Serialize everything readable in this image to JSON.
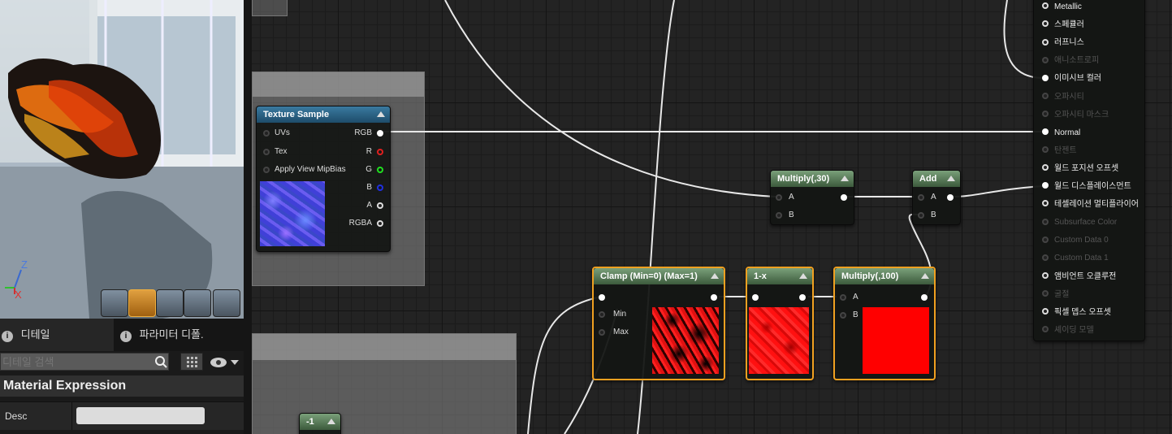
{
  "viewport": {
    "axis_z": "Z",
    "axis_x": "X",
    "preview_buttons": [
      "cylinder-preview-icon",
      "sphere-preview-icon",
      "plane-preview-icon",
      "cube-preview-icon",
      "custom-mesh-preview-icon"
    ]
  },
  "details": {
    "tab_details": "디테일",
    "tab_params": "파라미터 디폴.",
    "search_placeholder": "디테일 검색",
    "section_title": "Material Expression",
    "desc_label": "Desc",
    "desc_value": ""
  },
  "nodes": {
    "texture_sample": {
      "title": "Texture Sample",
      "inputs": [
        "UVs",
        "Tex",
        "Apply View MipBias"
      ],
      "outputs": [
        "RGB",
        "R",
        "G",
        "B",
        "A",
        "RGBA"
      ]
    },
    "multiply30": {
      "title": "Multiply(,30)",
      "inputs": [
        "A",
        "B"
      ]
    },
    "add": {
      "title": "Add",
      "inputs": [
        "A",
        "B"
      ]
    },
    "clamp": {
      "title": "Clamp (Min=0) (Max=1)",
      "inputs": [
        "Min",
        "Max"
      ]
    },
    "one_minus": {
      "title": "1-x"
    },
    "multiply100": {
      "title": "Multiply(,100)",
      "inputs": [
        "A",
        "B"
      ]
    },
    "const_neg1": {
      "title": "-1"
    }
  },
  "material_pins": [
    {
      "label": "Metallic",
      "active": true
    },
    {
      "label": "스페큘러",
      "active": true
    },
    {
      "label": "러프니스",
      "active": true
    },
    {
      "label": "애니소트로피",
      "active": false
    },
    {
      "label": "이미시브 컬러",
      "active": true
    },
    {
      "label": "오파시티",
      "active": false
    },
    {
      "label": "오파시티 마스크",
      "active": false
    },
    {
      "label": "Normal",
      "active": true
    },
    {
      "label": "탄젠트",
      "active": false
    },
    {
      "label": "월드 포지션 오프셋",
      "active": true
    },
    {
      "label": "월드 디스플레이스먼트",
      "active": true
    },
    {
      "label": "테셀레이션 멀티플라이어",
      "active": true
    },
    {
      "label": "Subsurface Color",
      "active": false
    },
    {
      "label": "Custom Data 0",
      "active": false
    },
    {
      "label": "Custom Data 1",
      "active": false
    },
    {
      "label": "앰비언트 오클루전",
      "active": true
    },
    {
      "label": "굴절",
      "active": false
    },
    {
      "label": "픽셀 뎁스 오프셋",
      "active": true
    },
    {
      "label": "셰이딩 모델",
      "active": false
    }
  ],
  "colors": {
    "pin_r": "#e02020",
    "pin_g": "#20e020",
    "pin_b": "#2020e0",
    "selected_border": "#f0a020"
  }
}
